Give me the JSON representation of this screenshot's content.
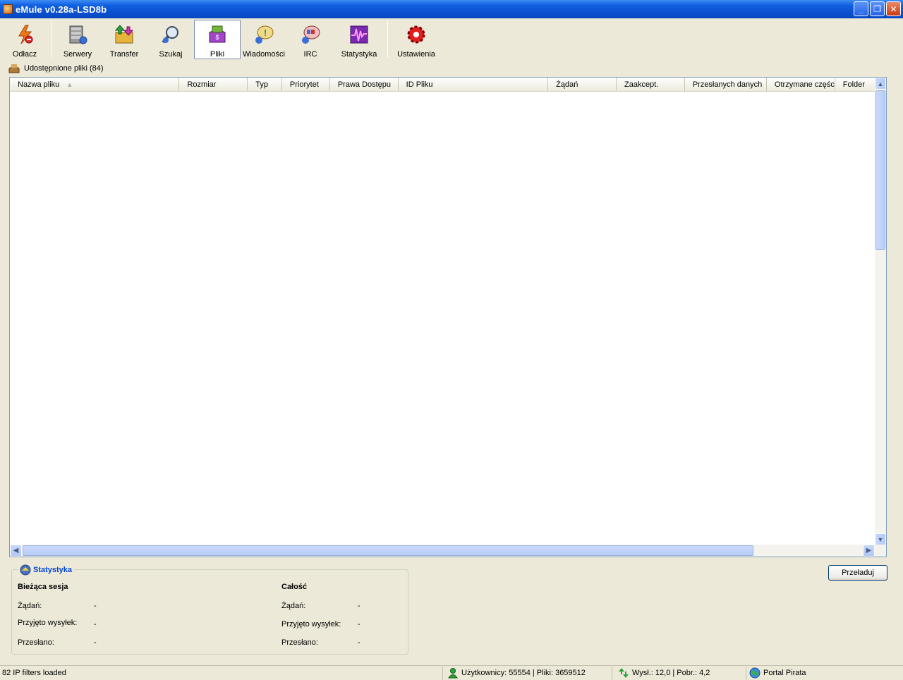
{
  "window": {
    "title": "eMule v0.28a-LSD8b",
    "minimize": "_",
    "maximize": "❐",
    "close": "✕"
  },
  "toolbar": {
    "items": [
      {
        "label": "Odłacz",
        "icon": "disconnect-icon"
      },
      {
        "label": "Serwery",
        "icon": "servers-icon"
      },
      {
        "label": "Transfer",
        "icon": "transfer-icon"
      },
      {
        "label": "Szukaj",
        "icon": "search-icon"
      },
      {
        "label": "Pliki",
        "icon": "shared-files-icon",
        "active": true
      },
      {
        "label": "Wiadomości",
        "icon": "messages-icon"
      },
      {
        "label": "IRC",
        "icon": "irc-icon"
      },
      {
        "label": "Statystyka",
        "icon": "statistics-icon"
      },
      {
        "label": "Ustawienia",
        "icon": "preferences-icon"
      }
    ]
  },
  "shared": {
    "label": "Udostępnione pliki (84)"
  },
  "list": {
    "columns": [
      "Nazwa pliku",
      "Rozmiar",
      "Typ",
      "Priorytet",
      "Prawa Dostępu",
      "ID Pliku",
      "Żądań",
      "Zaakcept.",
      "Przesłanych danych",
      "Otrzymane części",
      "Folder"
    ],
    "sort_indicator": "▲",
    "rows": []
  },
  "stats": {
    "title": "Statystyka",
    "session": {
      "heading": "Bieżąca sesja",
      "requests_label": "Żądań:",
      "requests_value": "-",
      "accepted_label": "Przyjęto wysyłek:",
      "accepted_value": "-",
      "transferred_label": "Przesłano:",
      "transferred_value": "-"
    },
    "total": {
      "heading": "Całość",
      "requests_label": "Żądań:",
      "requests_value": "-",
      "accepted_label": "Przyjęto wysyłek:",
      "accepted_value": "-",
      "transferred_label": "Przesłano:",
      "transferred_value": "-"
    }
  },
  "reload_button": "Przeładuj",
  "status": {
    "log": "82 IP filters loaded",
    "users": "Użytkownicy: 55554 | Pliki: 3659512",
    "speed": "Wysł.: 12,0 | Pobr.: 4,2",
    "server": "Portal Pirata"
  }
}
